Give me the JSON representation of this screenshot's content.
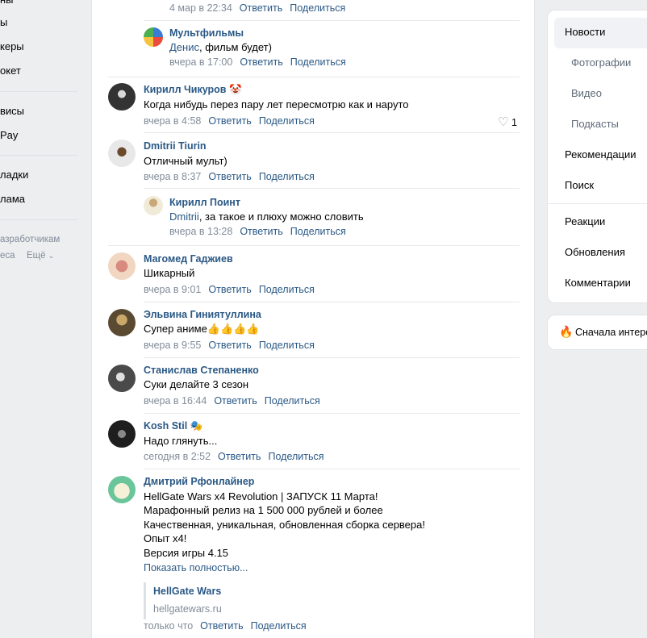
{
  "left_menu": {
    "items": [
      "ны",
      "ы",
      "керы",
      "окет",
      "висы",
      "Pay",
      "ладки",
      "лама"
    ],
    "footer_link_1": "азработчикам",
    "footer_link_2": "еса",
    "footer_more": "Ещё"
  },
  "comments": [
    {
      "meta": "4 мар в 22:34",
      "reply": "Ответить",
      "share": "Поделиться"
    },
    {
      "name": "Мультфильмы",
      "mention": "Денис",
      "text": ", фильм будет)",
      "meta": "вчера в 17:00",
      "reply": "Ответить",
      "share": "Поделиться"
    },
    {
      "name": "Кирилл Чикуров",
      "text": "Когда нибудь перез пару лет пересмотрю как и наруто",
      "meta": "вчера в 4:58",
      "reply": "Ответить",
      "share": "Поделиться",
      "likes": "1"
    },
    {
      "name": "Dmitrii Tiurin",
      "text": "Отличный мульт)",
      "meta": "вчера в 8:37",
      "reply": "Ответить",
      "share": "Поделиться"
    },
    {
      "name": "Кирилл Поинт",
      "mention": "Dmitrii",
      "text": ", за такое и плюху можно словить",
      "meta": "вчера в 13:28",
      "reply": "Ответить",
      "share": "Поделиться"
    },
    {
      "name": "Магомед Гаджиев",
      "text": "Шикарный",
      "meta": "вчера в 9:01",
      "reply": "Ответить",
      "share": "Поделиться"
    },
    {
      "name": "Эльвина Гиниятуллина",
      "text": "Супер аниме",
      "meta": "вчера в 9:55",
      "reply": "Ответить",
      "share": "Поделиться"
    },
    {
      "name": "Станислав Степаненко",
      "text": "Суки делайте 3 сезон",
      "meta": "вчера в 16:44",
      "reply": "Ответить",
      "share": "Поделиться"
    },
    {
      "name": "Kosh Stil",
      "text": "Надо глянуть...",
      "meta": "сегодня в 2:52",
      "reply": "Ответить",
      "share": "Поделиться"
    },
    {
      "name": "Дмитрий Рфонлайнер",
      "lines": [
        "HellGate Wars x4 Revolution | ЗАПУСК 11 Марта!",
        "Марафонный релиз на 1 500 000 рублей и более",
        "Качественная, уникальная, обновленная сборка сервера!",
        "Опыт x4!",
        "Версия игры 4.15"
      ],
      "show_more": "Показать полностью...",
      "link_title": "HellGate Wars",
      "link_url": "hellgatewars.ru",
      "meta": "только что",
      "reply": "Ответить",
      "share": "Поделиться"
    }
  ],
  "right_menu": {
    "items": [
      "Новости",
      "Фотографии",
      "Видео",
      "Подкасты",
      "Рекомендации",
      "Поиск",
      "Реакции",
      "Обновления",
      "Комментарии"
    ],
    "sort_label": "Сначала интере"
  },
  "colors": {
    "link": "#2a5885",
    "meta": "#818c99",
    "background": "#edeef0"
  }
}
